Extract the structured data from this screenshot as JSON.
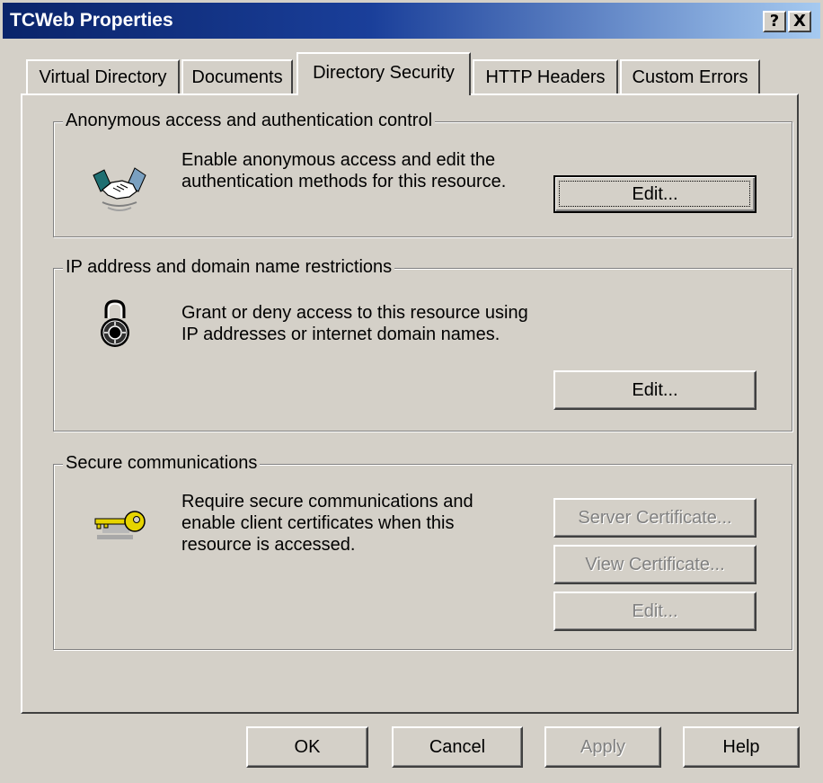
{
  "window": {
    "title": "TCWeb Properties",
    "help_button": "?",
    "close_button": "X"
  },
  "tabs": [
    {
      "label": "Virtual Directory",
      "active": false
    },
    {
      "label": "Documents",
      "active": false
    },
    {
      "label": "Directory Security",
      "active": true
    },
    {
      "label": "HTTP Headers",
      "active": false
    },
    {
      "label": "Custom Errors",
      "active": false
    }
  ],
  "anonymous": {
    "group_title": "Anonymous access and authentication control",
    "desc_line1": "Enable anonymous access and edit the",
    "desc_line2": "authentication methods for this resource.",
    "edit_label": "Edit..."
  },
  "ip": {
    "group_title": "IP address and domain name restrictions",
    "desc_line1": "Grant or deny access to this resource using",
    "desc_line2": "IP addresses or internet domain names.",
    "edit_label": "Edit..."
  },
  "secure": {
    "group_title": "Secure communications",
    "desc_line1": "Require secure communications and",
    "desc_line2": "enable client certificates when this",
    "desc_line3": "resource is accessed.",
    "server_cert_label": "Server Certificate...",
    "view_cert_label": "View Certificate...",
    "edit_label": "Edit..."
  },
  "footer": {
    "ok_label": "OK",
    "cancel_label": "Cancel",
    "apply_label": "Apply",
    "help_label": "Help"
  },
  "icons": {
    "anonymous": "handshake-icon",
    "ip": "padlock-icon",
    "secure": "key-icon"
  },
  "colors": {
    "title_gradient_start": "#0a246a",
    "title_gradient_end": "#a6caf0",
    "face": "#d4d0c8",
    "disabled_text": "#808080",
    "key_gold": "#e6d400"
  }
}
